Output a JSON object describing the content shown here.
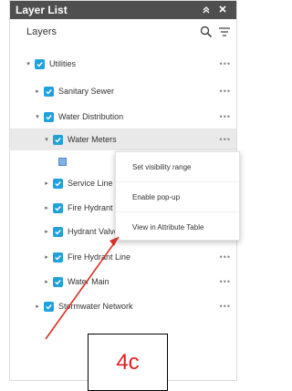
{
  "header": {
    "title": "Layer List"
  },
  "toolbar": {
    "layers_label": "Layers"
  },
  "layers": [
    {
      "label": "Utilities",
      "indent": 0,
      "expanded": true,
      "more": "•••"
    },
    {
      "label": "Sanitary Sewer",
      "indent": 1,
      "expanded": false,
      "more": "•••"
    },
    {
      "label": "Water Distribution",
      "indent": 1,
      "expanded": true,
      "more": "•••"
    },
    {
      "label": "Water Meters",
      "indent": 2,
      "expanded": true,
      "selected": true,
      "more": "•••"
    },
    {
      "label": "Service Line",
      "indent": 2,
      "expanded": false,
      "more": "•••"
    },
    {
      "label": "Fire Hydrant",
      "indent": 2,
      "expanded": false,
      "more": "•••"
    },
    {
      "label": "Hydrant Valve",
      "indent": 2,
      "expanded": false,
      "more": "•••"
    },
    {
      "label": "Fire Hydrant Line",
      "indent": 2,
      "expanded": false,
      "more": "•••"
    },
    {
      "label": "Water Main",
      "indent": 2,
      "expanded": false,
      "more": "•••"
    },
    {
      "label": "Stormwater Network",
      "indent": 1,
      "expanded": false,
      "more": "•••"
    }
  ],
  "context_menu": {
    "items": [
      "Set visibility range",
      "Enable pop-up",
      "View in Attribute Table"
    ]
  },
  "annotation": {
    "label": "4c"
  },
  "colors": {
    "title_bg": "#4f4f4f",
    "checkbox": "#1fa1dc",
    "arrow": "#d93025"
  }
}
